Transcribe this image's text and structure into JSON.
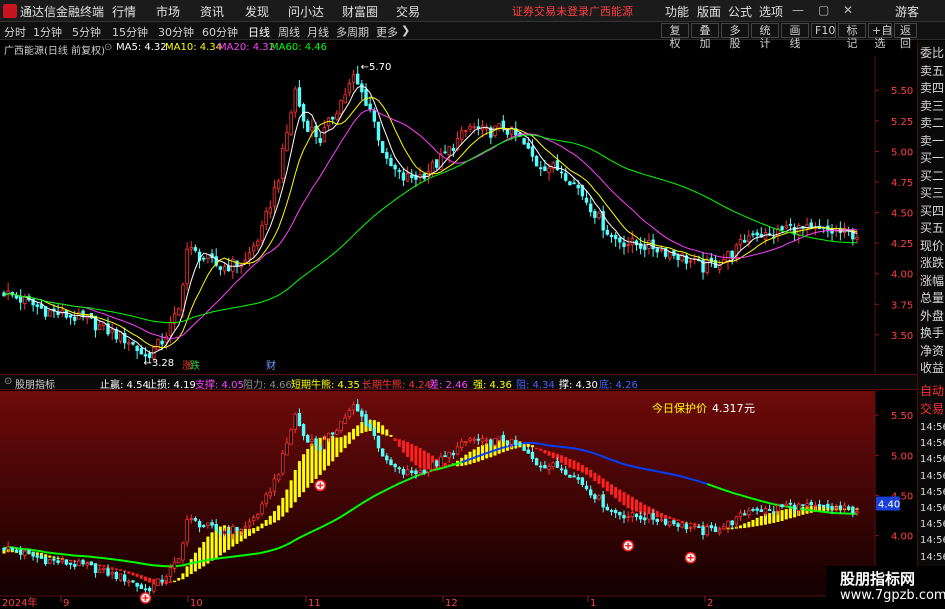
{
  "app": {
    "title": "通达信金融终端",
    "menus": [
      "行情",
      "市场",
      "资讯",
      "发现",
      "问小达",
      "财富圈",
      "交易"
    ],
    "notice": "证券交易未登录",
    "stock_name": "广西能源",
    "right_menus": [
      "功能",
      "版面",
      "公式",
      "选项"
    ],
    "user": "游客"
  },
  "toolbar": {
    "periods": [
      "分时",
      "1分钟",
      "5分钟",
      "15分钟",
      "30分钟",
      "60分钟",
      "日线",
      "周线",
      "月线",
      "多周期",
      "更多"
    ],
    "active_period": "日线",
    "more_arrow": "❯",
    "buttons": [
      "复权",
      "叠加",
      "多股",
      "统计",
      "画线",
      "F10",
      "标记",
      "+自选",
      "返回"
    ]
  },
  "main_chart": {
    "title": "广西能源(日线 前复权)",
    "ma": [
      {
        "label": "MA5: 4.32",
        "color": "#ffffff"
      },
      {
        "label": "MA10: 4.34",
        "color": "#ffff00"
      },
      {
        "label": "MA20: 4.32",
        "color": "#ff40ff"
      },
      {
        "label": "MA60: 4.46",
        "color": "#00ff00"
      }
    ],
    "y_labels": [
      "5.50",
      "5.25",
      "5.00",
      "4.75",
      "4.50",
      "4.25",
      "4.00",
      "3.75",
      "3.50"
    ],
    "high_mark": "5.70",
    "low_mark": "3.28",
    "event_labels": [
      "涨",
      "跌",
      "财"
    ]
  },
  "indicator": {
    "name": "股朋指标",
    "values": [
      {
        "label": "止赢: 4.54",
        "color": "#ffffff"
      },
      {
        "label": "止损: 4.19",
        "color": "#ffffff"
      },
      {
        "label": "支撑: 4.05",
        "color": "#ff40ff"
      },
      {
        "label": "阻力: 4.66",
        "color": "#888888"
      },
      {
        "label": "短期牛熊: 4.35",
        "color": "#ffff00"
      },
      {
        "label": "长期牛熊: 4.24",
        "color": "#ff3030"
      },
      {
        "label": "差: 2.46",
        "color": "#ff40ff"
      },
      {
        "label": "强: 4.36",
        "color": "#ffff00"
      },
      {
        "label": "阻: 4.34",
        "color": "#4060ff"
      },
      {
        "label": "撑: 4.30",
        "color": "#ffffff"
      },
      {
        "label": "底: 4.26",
        "color": "#4060ff"
      }
    ],
    "protect_label": "今日保护价",
    "protect_value": "4.317",
    "protect_unit": "元",
    "y_labels": [
      "5.50",
      "5.00",
      "4.50",
      "4.00"
    ],
    "current_value": "4.40"
  },
  "x_axis": {
    "labels": [
      "2024年",
      "9",
      "10",
      "11",
      "12",
      "1",
      "2"
    ]
  },
  "right_panel": {
    "items": [
      "委比",
      "卖五",
      "卖四",
      "卖三",
      "卖二",
      "卖一",
      "买一",
      "买二",
      "买三",
      "买四",
      "买五",
      "现价",
      "涨跌",
      "涨幅",
      "总量",
      "外盘",
      "换手",
      "净资",
      "收益"
    ],
    "bottom_items": [
      "自动",
      "交易"
    ],
    "times": [
      "14:56",
      "14:56",
      "14:56",
      "14:56",
      "14:56",
      "14:56",
      "14:56",
      "14:56",
      "14:56",
      "14:56",
      "14:56"
    ]
  },
  "watermark": {
    "name": "股朋指标网",
    "url": "www.7gpzb.com"
  },
  "colors": {
    "up": "#ff3232",
    "down": "#54ffff",
    "ma5": "#ffffff",
    "ma10": "#ffff00",
    "ma20": "#ff40ff",
    "ma60": "#00ff00"
  }
}
